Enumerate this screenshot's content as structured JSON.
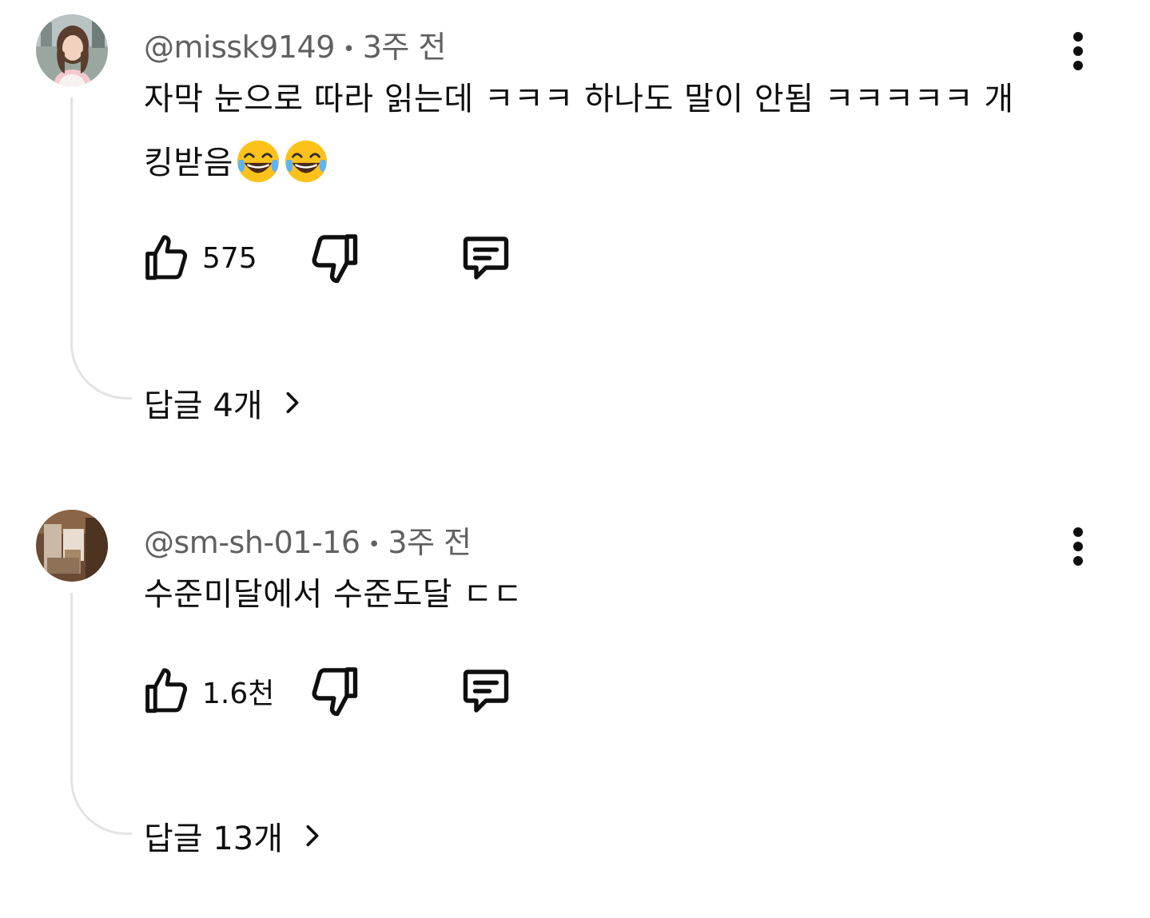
{
  "comments": [
    {
      "handle": "@missk9149",
      "time": "3주 전",
      "text": "자막 눈으로 따라 읽는데 ㅋㅋㅋ 하나도 말이 안됨 ㅋㅋㅋㅋㅋ 개킹받음",
      "emoji_count": 2,
      "emoji_name": "face-with-tears-of-joy",
      "likes": "575",
      "replies_label": "답글 4개"
    },
    {
      "handle": "@sm-sh-01-16",
      "time": "3주 전",
      "text": "수준미달에서 수준도달 ㄷㄷ",
      "likes": "1.6천",
      "replies_label": "답글 13개"
    }
  ],
  "separator": "•",
  "icons": {
    "like": "thumbs-up-icon",
    "dislike": "thumbs-down-icon",
    "reply": "comment-icon",
    "more": "more-vertical-icon",
    "chevron": "chevron-right-icon"
  },
  "colors": {
    "text": "#0f0f0f",
    "meta": "#606060",
    "thread_line": "#e3e3e3",
    "background": "#ffffff"
  }
}
